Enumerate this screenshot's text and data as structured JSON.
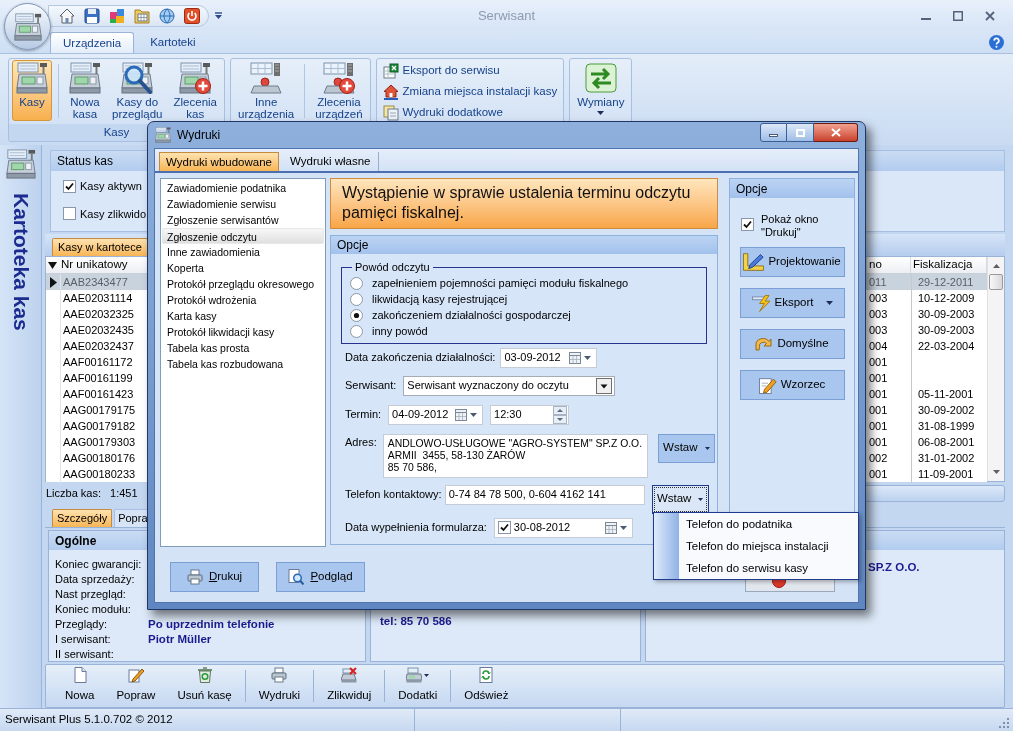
{
  "window": {
    "title": "Serwisant"
  },
  "ribbon": {
    "tabs": [
      {
        "label": "Urządzenia",
        "selected": true
      },
      {
        "label": "Kartoteki",
        "selected": false
      }
    ],
    "groups": [
      {
        "kind": "large",
        "label": "Kasy",
        "buttons": [
          {
            "label": "Kasy",
            "selected": true,
            "kind": "button"
          },
          {
            "label": "Nowa\nkasa",
            "selected": false,
            "kind": "button"
          },
          {
            "label": "Kasy do\nprzeglądu",
            "selected": false,
            "kind": "button"
          },
          {
            "label": "Zlecenia\nkas",
            "selected": false,
            "kind": "button"
          }
        ]
      },
      {
        "kind": "large",
        "buttons": [
          {
            "label": "Inne\nurządzenia",
            "selected": false,
            "kind": "button"
          },
          {
            "label": "Zlecenia\nurządzeń",
            "selected": false,
            "kind": "button"
          }
        ]
      },
      {
        "kind": "small",
        "buttons": [
          {
            "label": "Eksport do serwisu"
          },
          {
            "label": "Zmiana miejsca instalacji kasy"
          },
          {
            "label": "Wydruki dodatkowe"
          }
        ]
      },
      {
        "kind": "large",
        "buttons": [
          {
            "label": "Wymiany",
            "selected": false,
            "kind": "dropdown"
          }
        ]
      }
    ]
  },
  "sidebar": {
    "title": "Kartoteka kas"
  },
  "status_filter": {
    "title": "Status kas",
    "options": [
      {
        "label": "Kasy aktywn",
        "checked": true
      },
      {
        "label": "Kasy zlikwido",
        "checked": false
      }
    ]
  },
  "register_list": {
    "tab": {
      "label": "Kasy w kartotece",
      "selected": true
    },
    "columns": [
      {
        "label": "Nr unikatowy",
        "sorted": true
      },
      {
        "label": "no",
        "sorted": false
      },
      {
        "label": "Fiskalizacja",
        "sorted": false
      }
    ],
    "rows": [
      {
        "nr_unikatowy": "AAB2343477",
        "column_2": "011",
        "fiskalizacja": "29-12-2011",
        "selected": true
      },
      {
        "nr_unikatowy": "AAE02031114",
        "column_2": "003",
        "fiskalizacja": "10-12-2009",
        "selected": false
      },
      {
        "nr_unikatowy": "AAE02032325",
        "column_2": "003",
        "fiskalizacja": "30-09-2003",
        "selected": false
      },
      {
        "nr_unikatowy": "AAE02032435",
        "column_2": "003",
        "fiskalizacja": "30-09-2003",
        "selected": false
      },
      {
        "nr_unikatowy": "AAE02032437",
        "column_2": "004",
        "fiskalizacja": "22-03-2004",
        "selected": false
      },
      {
        "nr_unikatowy": "AAF00161172",
        "column_2": "001",
        "selected": false
      },
      {
        "nr_unikatowy": "AAF00161199",
        "column_2": "001",
        "selected": false
      },
      {
        "nr_unikatowy": "AAF00161423",
        "column_2": "001",
        "fiskalizacja": "05-11-2001",
        "selected": false
      },
      {
        "nr_unikatowy": "AAG00179175",
        "column_2": "001",
        "fiskalizacja": "30-09-2002",
        "selected": false
      },
      {
        "nr_unikatowy": "AAG00179182",
        "column_2": "001",
        "fiskalizacja": "31-08-1999",
        "selected": false
      },
      {
        "nr_unikatowy": "AAG00179303",
        "column_2": "001",
        "fiskalizacja": "06-08-2001",
        "selected": false
      },
      {
        "nr_unikatowy": "AAG00180176",
        "column_2": "002",
        "fiskalizacja": "31-01-2002",
        "selected": false
      },
      {
        "nr_unikatowy": "AAG00180233",
        "column_2": "001",
        "fiskalizacja": "11-09-2001",
        "selected": false
      }
    ],
    "count_label": "Liczba kas:",
    "count": "1:451"
  },
  "details": {
    "tabs": [
      {
        "label": "Szczegóły",
        "selected": true
      },
      {
        "label": "Popra",
        "selected": false
      }
    ],
    "general": {
      "title": "Ogólne",
      "fields": [
        {
          "label": "Koniec gwarancji:"
        },
        {
          "label": "Data sprzedaży:"
        },
        {
          "label": "Nast przegląd:"
        },
        {
          "label": "Koniec modułu:"
        },
        {
          "label": "Przeglądy:",
          "value": "Po uprzednim telefonie"
        },
        {
          "label": "I serwisant:",
          "value": "Piotr Müller"
        },
        {
          "label": "II serwisant:"
        }
      ]
    },
    "contact_panel": {
      "text": "tel: 85 70 586"
    },
    "client_panel": {
      "text": "SP.Z O.O."
    }
  },
  "toolbar": {
    "groups": [
      {
        "buttons": [
          {
            "label": "Nowa",
            "kind": "button"
          },
          {
            "label": "Popraw",
            "kind": "button"
          },
          {
            "label": "Usuń kasę",
            "kind": "button"
          }
        ]
      },
      {
        "buttons": [
          {
            "label": "Wydruki",
            "kind": "button"
          }
        ]
      },
      {
        "buttons": [
          {
            "label": "Zlikwiduj",
            "kind": "button"
          }
        ]
      },
      {
        "buttons": [
          {
            "label": "Dodatki",
            "kind": "dropdown"
          }
        ]
      },
      {
        "buttons": [
          {
            "label": "Odśwież",
            "kind": "button"
          }
        ]
      }
    ]
  },
  "status_bar": {
    "text": "Serwisant Plus 5.1.0.702 © 2012"
  },
  "dialog": {
    "title": "Wydruki",
    "tabs": [
      {
        "label": "Wydruki wbudowane",
        "selected": true
      },
      {
        "label": "Wydruki własne",
        "selected": false
      }
    ],
    "reports": [
      {
        "label": "Zawiadomienie podatnika",
        "selected": false
      },
      {
        "label": "Zawiadomienie serwisu",
        "selected": false
      },
      {
        "label": "Zgłoszenie serwisantów",
        "selected": false
      },
      {
        "label": "Zgłoszenie odczytu",
        "selected": true
      },
      {
        "label": "Inne zawiadomienia",
        "selected": false
      },
      {
        "label": "Koperta",
        "selected": false
      },
      {
        "label": "Protokół przeglądu okresowego",
        "selected": false
      },
      {
        "label": "Protokół wdrożenia",
        "selected": false
      },
      {
        "label": "Karta kasy",
        "selected": false
      },
      {
        "label": "Protokół likwidacji kasy",
        "selected": false
      },
      {
        "label": "Tabela kas prosta",
        "selected": false
      },
      {
        "label": "Tabela kas rozbudowana",
        "selected": false
      }
    ],
    "banner": "Wystąpienie w sprawie ustalenia terminu odczytu\npamięci fiskalnej.",
    "options": {
      "title": "Opcje",
      "reason": {
        "legend": "Powód odczytu",
        "choices": [
          {
            "label": "zapełnieniem pojemności pamięci modułu fiskalnego",
            "selected": false
          },
          {
            "label": "likwidacją kasy rejestrującej",
            "selected": false
          },
          {
            "label": "zakończeniem działalności gospodarczej",
            "selected": true
          },
          {
            "label": "inny powód",
            "selected": false
          }
        ]
      },
      "fields": [
        {
          "kind": "date",
          "label": "Data zakończenia działalności:",
          "value": "03-09-2012"
        },
        {
          "kind": "combo",
          "label": "Serwisant:",
          "value": "Serwisant wyznaczony do oczytu"
        },
        {
          "kind": "datetime",
          "label": "Termin:",
          "value": "04-09-2012",
          "time": "12:30"
        },
        {
          "kind": "address",
          "label": "Adres:",
          "lines": [
            "ANDLOWO-USŁUGOWE \"AGRO-SYSTEM\" SP.Z O.O.",
            "ARMII  3455, 58-130 ŻARÓW",
            "85 70 586,"
          ],
          "button": "Wstaw"
        },
        {
          "kind": "phone",
          "label": "Telefon kontaktowy:",
          "value": "0-74 84 78 500, 0-604 4162 141",
          "button": "Wstaw",
          "menu_items": [
            "Telefon do podatnika",
            "Telefon do miejsca instalacji",
            "Telefon do serwisu kasy"
          ]
        },
        {
          "kind": "checkdate",
          "label": "Data wypełnienia formularza:",
          "value": "30-08-2012",
          "checked": true
        }
      ]
    },
    "side": {
      "title": "Opcje",
      "show_print": {
        "label": "Pokaż okno\n\"Drukuj\"",
        "checked": true
      },
      "buttons": [
        {
          "label": "Projektowanie",
          "dropdown": false
        },
        {
          "label": "Eksport",
          "dropdown": true
        },
        {
          "label": "Domyślne",
          "dropdown": false
        },
        {
          "label": "Wzorzec",
          "dropdown": false
        }
      ]
    },
    "buttons": [
      {
        "label": "Drukuj"
      },
      {
        "label": "Podgląd"
      }
    ]
  }
}
